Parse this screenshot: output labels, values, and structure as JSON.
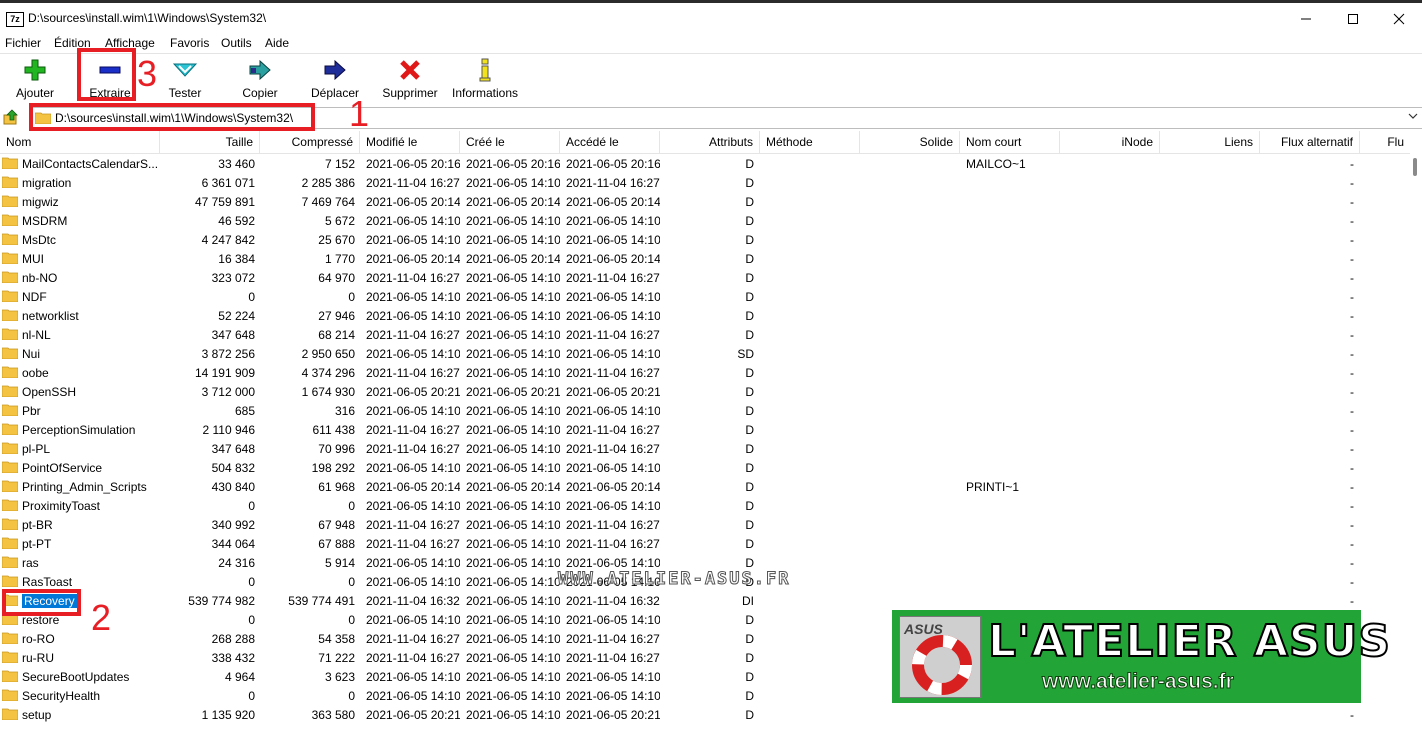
{
  "window": {
    "title": "D:\\sources\\install.wim\\1\\Windows\\System32\\",
    "app_icon_text": "7z"
  },
  "menu": [
    "Fichier",
    "Édition",
    "Affichage",
    "Favoris",
    "Outils",
    "Aide"
  ],
  "toolbar": {
    "add": "Ajouter",
    "extract": "Extraire",
    "test": "Tester",
    "copy": "Copier",
    "move": "Déplacer",
    "delete": "Supprimer",
    "info": "Informations"
  },
  "address": {
    "value": "D:\\sources\\install.wim\\1\\Windows\\System32\\"
  },
  "columns": {
    "name": "Nom",
    "size": "Taille",
    "packed": "Compressé",
    "modified": "Modifié le",
    "created": "Créé le",
    "accessed": "Accédé le",
    "attributes": "Attributs",
    "method": "Méthode",
    "solid": "Solide",
    "short_name": "Nom court",
    "inode": "iNode",
    "links": "Liens",
    "alt_streams": "Flux alternatif",
    "more": "Flu"
  },
  "rows": [
    {
      "name": "MailContactsCalendarS...",
      "size": "33 460",
      "packed": "7 152",
      "modified": "2021-06-05 20:16",
      "created": "2021-06-05 20:16",
      "accessed": "2021-06-05 20:16",
      "attr": "D",
      "short": "MAILCO~1",
      "alt": "-"
    },
    {
      "name": "migration",
      "size": "6 361 071",
      "packed": "2 285 386",
      "modified": "2021-11-04 16:27",
      "created": "2021-06-05 14:10",
      "accessed": "2021-11-04 16:27",
      "attr": "D",
      "short": "",
      "alt": "-"
    },
    {
      "name": "migwiz",
      "size": "47 759 891",
      "packed": "7 469 764",
      "modified": "2021-06-05 20:14",
      "created": "2021-06-05 20:14",
      "accessed": "2021-06-05 20:14",
      "attr": "D",
      "short": "",
      "alt": "-"
    },
    {
      "name": "MSDRM",
      "size": "46 592",
      "packed": "5 672",
      "modified": "2021-06-05 14:10",
      "created": "2021-06-05 14:10",
      "accessed": "2021-06-05 14:10",
      "attr": "D",
      "short": "",
      "alt": "-"
    },
    {
      "name": "MsDtc",
      "size": "4 247 842",
      "packed": "25 670",
      "modified": "2021-06-05 14:10",
      "created": "2021-06-05 14:10",
      "accessed": "2021-06-05 14:10",
      "attr": "D",
      "short": "",
      "alt": "-"
    },
    {
      "name": "MUI",
      "size": "16 384",
      "packed": "1 770",
      "modified": "2021-06-05 20:14",
      "created": "2021-06-05 20:14",
      "accessed": "2021-06-05 20:14",
      "attr": "D",
      "short": "",
      "alt": "-"
    },
    {
      "name": "nb-NO",
      "size": "323 072",
      "packed": "64 970",
      "modified": "2021-11-04 16:27",
      "created": "2021-06-05 14:10",
      "accessed": "2021-11-04 16:27",
      "attr": "D",
      "short": "",
      "alt": "-"
    },
    {
      "name": "NDF",
      "size": "0",
      "packed": "0",
      "modified": "2021-06-05 14:10",
      "created": "2021-06-05 14:10",
      "accessed": "2021-06-05 14:10",
      "attr": "D",
      "short": "",
      "alt": "-"
    },
    {
      "name": "networklist",
      "size": "52 224",
      "packed": "27 946",
      "modified": "2021-06-05 14:10",
      "created": "2021-06-05 14:10",
      "accessed": "2021-06-05 14:10",
      "attr": "D",
      "short": "",
      "alt": "-"
    },
    {
      "name": "nl-NL",
      "size": "347 648",
      "packed": "68 214",
      "modified": "2021-11-04 16:27",
      "created": "2021-06-05 14:10",
      "accessed": "2021-11-04 16:27",
      "attr": "D",
      "short": "",
      "alt": "-"
    },
    {
      "name": "Nui",
      "size": "3 872 256",
      "packed": "2 950 650",
      "modified": "2021-06-05 14:10",
      "created": "2021-06-05 14:10",
      "accessed": "2021-06-05 14:10",
      "attr": "SD",
      "short": "",
      "alt": "-"
    },
    {
      "name": "oobe",
      "size": "14 191 909",
      "packed": "4 374 296",
      "modified": "2021-11-04 16:27",
      "created": "2021-06-05 14:10",
      "accessed": "2021-11-04 16:27",
      "attr": "D",
      "short": "",
      "alt": "-"
    },
    {
      "name": "OpenSSH",
      "size": "3 712 000",
      "packed": "1 674 930",
      "modified": "2021-06-05 20:21",
      "created": "2021-06-05 20:21",
      "accessed": "2021-06-05 20:21",
      "attr": "D",
      "short": "",
      "alt": "-"
    },
    {
      "name": "Pbr",
      "size": "685",
      "packed": "316",
      "modified": "2021-06-05 14:10",
      "created": "2021-06-05 14:10",
      "accessed": "2021-06-05 14:10",
      "attr": "D",
      "short": "",
      "alt": "-"
    },
    {
      "name": "PerceptionSimulation",
      "size": "2 110 946",
      "packed": "611 438",
      "modified": "2021-11-04 16:27",
      "created": "2021-06-05 14:10",
      "accessed": "2021-11-04 16:27",
      "attr": "D",
      "short": "",
      "alt": "-"
    },
    {
      "name": "pl-PL",
      "size": "347 648",
      "packed": "70 996",
      "modified": "2021-11-04 16:27",
      "created": "2021-06-05 14:10",
      "accessed": "2021-11-04 16:27",
      "attr": "D",
      "short": "",
      "alt": "-"
    },
    {
      "name": "PointOfService",
      "size": "504 832",
      "packed": "198 292",
      "modified": "2021-06-05 14:10",
      "created": "2021-06-05 14:10",
      "accessed": "2021-06-05 14:10",
      "attr": "D",
      "short": "",
      "alt": "-"
    },
    {
      "name": "Printing_Admin_Scripts",
      "size": "430 840",
      "packed": "61 968",
      "modified": "2021-06-05 20:14",
      "created": "2021-06-05 20:14",
      "accessed": "2021-06-05 20:14",
      "attr": "D",
      "short": "PRINTI~1",
      "alt": "-"
    },
    {
      "name": "ProximityToast",
      "size": "0",
      "packed": "0",
      "modified": "2021-06-05 14:10",
      "created": "2021-06-05 14:10",
      "accessed": "2021-06-05 14:10",
      "attr": "D",
      "short": "",
      "alt": "-"
    },
    {
      "name": "pt-BR",
      "size": "340 992",
      "packed": "67 948",
      "modified": "2021-11-04 16:27",
      "created": "2021-06-05 14:10",
      "accessed": "2021-11-04 16:27",
      "attr": "D",
      "short": "",
      "alt": "-"
    },
    {
      "name": "pt-PT",
      "size": "344 064",
      "packed": "67 888",
      "modified": "2021-11-04 16:27",
      "created": "2021-06-05 14:10",
      "accessed": "2021-11-04 16:27",
      "attr": "D",
      "short": "",
      "alt": "-"
    },
    {
      "name": "ras",
      "size": "24 316",
      "packed": "5 914",
      "modified": "2021-06-05 14:10",
      "created": "2021-06-05 14:10",
      "accessed": "2021-06-05 14:10",
      "attr": "D",
      "short": "",
      "alt": "-"
    },
    {
      "name": "RasToast",
      "size": "0",
      "packed": "0",
      "modified": "2021-06-05 14:10",
      "created": "2021-06-05 14:10",
      "accessed": "2021-06-05 14:10",
      "attr": "D",
      "short": "",
      "alt": "-"
    },
    {
      "name": "Recovery",
      "size": "539 774 982",
      "packed": "539 774 491",
      "modified": "2021-11-04 16:32",
      "created": "2021-06-05 14:10",
      "accessed": "2021-11-04 16:32",
      "attr": "DI",
      "short": "",
      "alt": "-",
      "selected": true
    },
    {
      "name": "restore",
      "size": "0",
      "packed": "0",
      "modified": "2021-06-05 14:10",
      "created": "2021-06-05 14:10",
      "accessed": "2021-06-05 14:10",
      "attr": "D",
      "short": "",
      "alt": ""
    },
    {
      "name": "ro-RO",
      "size": "268 288",
      "packed": "54 358",
      "modified": "2021-11-04 16:27",
      "created": "2021-06-05 14:10",
      "accessed": "2021-11-04 16:27",
      "attr": "D",
      "short": "",
      "alt": ""
    },
    {
      "name": "ru-RU",
      "size": "338 432",
      "packed": "71 222",
      "modified": "2021-11-04 16:27",
      "created": "2021-06-05 14:10",
      "accessed": "2021-11-04 16:27",
      "attr": "D",
      "short": "",
      "alt": ""
    },
    {
      "name": "SecureBootUpdates",
      "size": "4 964",
      "packed": "3 623",
      "modified": "2021-06-05 14:10",
      "created": "2021-06-05 14:10",
      "accessed": "2021-06-05 14:10",
      "attr": "D",
      "short": "",
      "alt": ""
    },
    {
      "name": "SecurityHealth",
      "size": "0",
      "packed": "0",
      "modified": "2021-06-05 14:10",
      "created": "2021-06-05 14:10",
      "accessed": "2021-06-05 14:10",
      "attr": "D",
      "short": "",
      "alt": ""
    },
    {
      "name": "setup",
      "size": "1 135 920",
      "packed": "363 580",
      "modified": "2021-06-05 20:21",
      "created": "2021-06-05 14:10",
      "accessed": "2021-06-05 20:21",
      "attr": "D",
      "short": "",
      "alt": "-"
    }
  ],
  "annotations": {
    "n1": "1",
    "n2": "2",
    "n3": "3"
  },
  "watermark": "WWW.ATELIER-ASUS.FR",
  "banner": {
    "logo": "ASUS",
    "title": "L'ATELIER ASUS",
    "url": "www.atelier-asus.fr"
  },
  "colors": {
    "annotation_red": "#e81e25",
    "banner_green": "#22a536",
    "selection_blue": "#0078d7",
    "folder_yellow": "#f5c342"
  }
}
